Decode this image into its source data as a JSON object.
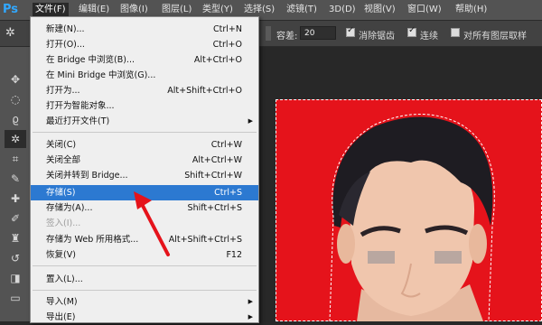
{
  "app_logo": "Ps",
  "menubar": {
    "items": [
      "文件(F)",
      "编辑(E)",
      "图像(I)",
      "图层(L)",
      "类型(Y)",
      "选择(S)",
      "滤镜(T)",
      "3D(D)",
      "视图(V)",
      "窗口(W)",
      "帮助(H)"
    ]
  },
  "options": {
    "tolerance_label": "容差:",
    "tolerance_value": "20",
    "antialias_label": "消除锯齿",
    "contiguous_label": "连续",
    "sample_all_label": "对所有图层取样"
  },
  "file_menu": [
    {
      "label": "新建(N)...",
      "shortcut": "Ctrl+N"
    },
    {
      "label": "打开(O)...",
      "shortcut": "Ctrl+O"
    },
    {
      "label": "在 Bridge 中浏览(B)...",
      "shortcut": "Alt+Ctrl+O"
    },
    {
      "label": "在 Mini Bridge 中浏览(G)...",
      "shortcut": ""
    },
    {
      "label": "打开为...",
      "shortcut": "Alt+Shift+Ctrl+O"
    },
    {
      "label": "打开为智能对象...",
      "shortcut": ""
    },
    {
      "label": "最近打开文件(T)",
      "shortcut": "",
      "submenu": true
    },
    {
      "label": "关闭(C)",
      "shortcut": "Ctrl+W"
    },
    {
      "label": "关闭全部",
      "shortcut": "Alt+Ctrl+W"
    },
    {
      "label": "关闭并转到 Bridge...",
      "shortcut": "Shift+Ctrl+W"
    },
    {
      "label": "存储(S)",
      "shortcut": "Ctrl+S",
      "highlight": true
    },
    {
      "label": "存储为(A)...",
      "shortcut": "Shift+Ctrl+S"
    },
    {
      "label": "签入(I)...",
      "shortcut": "",
      "disabled": true
    },
    {
      "label": "存储为 Web 所用格式...",
      "shortcut": "Alt+Shift+Ctrl+S"
    },
    {
      "label": "恢复(V)",
      "shortcut": "F12"
    },
    {
      "label": "置入(L)...",
      "shortcut": ""
    },
    {
      "label": "导入(M)",
      "shortcut": "",
      "submenu": true
    },
    {
      "label": "导出(E)",
      "shortcut": "",
      "submenu": true
    }
  ],
  "colors": {
    "highlight": "#2c79d1",
    "canvas_bg": "#e5131b",
    "arrow": "#e5131b"
  }
}
